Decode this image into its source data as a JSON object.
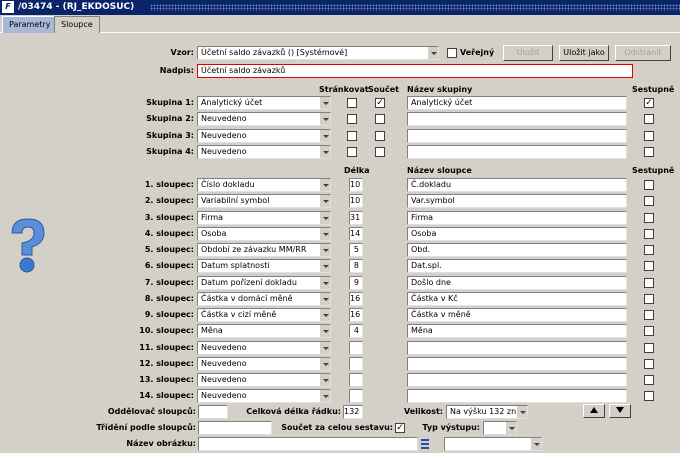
{
  "window": {
    "title": "/03474 - (RJ_EKDOSUC)"
  },
  "tabs": [
    "Parametry",
    "Sloupce"
  ],
  "vzor": {
    "label": "Vzor:",
    "value": "Účetní saldo závazků   ()   [Systémové]",
    "verejny_label": "Veřejný",
    "verejny_checked": false
  },
  "buttons": {
    "ulozit": "Uložit",
    "ulozit_jako": "Uložit jako",
    "odstranit": "Odstranit"
  },
  "nadpis": {
    "label": "Nadpis:",
    "value": "Účetní saldo závazků"
  },
  "group_headers": {
    "strankovat": "Stránkovat",
    "soucet": "Součet",
    "nazev_skupiny": "Název skupiny",
    "sestupne": "Sestupně"
  },
  "groups": [
    {
      "label": "Skupina 1:",
      "value": "Analytický účet",
      "strankovat": false,
      "soucet": true,
      "name": "Analytický účet",
      "sestupne": true
    },
    {
      "label": "Skupina 2:",
      "value": "Neuvedeno",
      "strankovat": false,
      "soucet": false,
      "name": "",
      "sestupne": false
    },
    {
      "label": "Skupina 3:",
      "value": "Neuvedeno",
      "strankovat": false,
      "soucet": false,
      "name": "",
      "sestupne": false
    },
    {
      "label": "Skupina 4:",
      "value": "Neuvedeno",
      "strankovat": false,
      "soucet": false,
      "name": "",
      "sestupne": false
    }
  ],
  "column_headers": {
    "delka": "Délka",
    "nazev_sloupce": "Název sloupce",
    "sestupne": "Sestupně"
  },
  "columns": [
    {
      "label": "1. sloupec:",
      "value": "Číslo dokladu",
      "delka": "10",
      "name": "Č.dokladu"
    },
    {
      "label": "2. sloupec:",
      "value": "Variabilní symbol",
      "delka": "10",
      "name": "Var.symbol"
    },
    {
      "label": "3. sloupec:",
      "value": "Firma",
      "delka": "31",
      "name": "Firma"
    },
    {
      "label": "4. sloupec:",
      "value": "Osoba",
      "delka": "14",
      "name": "Osoba"
    },
    {
      "label": "5. sloupec:",
      "value": "Období ze závazku MM/RR",
      "delka": "5",
      "name": "Obd."
    },
    {
      "label": "6. sloupec:",
      "value": "Datum splatnosti",
      "delka": "8",
      "name": "Dat.spl."
    },
    {
      "label": "7. sloupec:",
      "value": "Datum pořízení dokladu",
      "delka": "9",
      "name": "Došlo dne"
    },
    {
      "label": "8. sloupec:",
      "value": "Částka v domácí měně",
      "delka": "16",
      "name": "Částka v Kč"
    },
    {
      "label": "9. sloupec:",
      "value": "Částka v cizí měně",
      "delka": "16",
      "name": "Částka v měně"
    },
    {
      "label": "10. sloupec:",
      "value": "Měna",
      "delka": "4",
      "name": "Měna"
    },
    {
      "label": "11. sloupec:",
      "value": "Neuvedeno",
      "delka": "",
      "name": ""
    },
    {
      "label": "12. sloupec:",
      "value": "Neuvedeno",
      "delka": "",
      "name": ""
    },
    {
      "label": "13. sloupec:",
      "value": "Neuvedeno",
      "delka": "",
      "name": ""
    },
    {
      "label": "14. sloupec:",
      "value": "Neuvedeno",
      "delka": "",
      "name": ""
    }
  ],
  "footer": {
    "oddelovac_label": "Oddělovač sloupců:",
    "oddelovac_value": "",
    "celkova_label": "Celková délka řádku:",
    "celkova_value": "132",
    "velikost_label": "Velikost:",
    "velikost_value": "Na výšku 132 zn.",
    "trideni_label": "Třídění podle sloupců:",
    "trideni_value": "",
    "soucet_label": "Součet za celou sestavu:",
    "soucet_checked": true,
    "typ_label": "Typ výstupu:",
    "typ_value": "",
    "obrazek_label": "Název obrázku:",
    "obrazek_value": ""
  }
}
